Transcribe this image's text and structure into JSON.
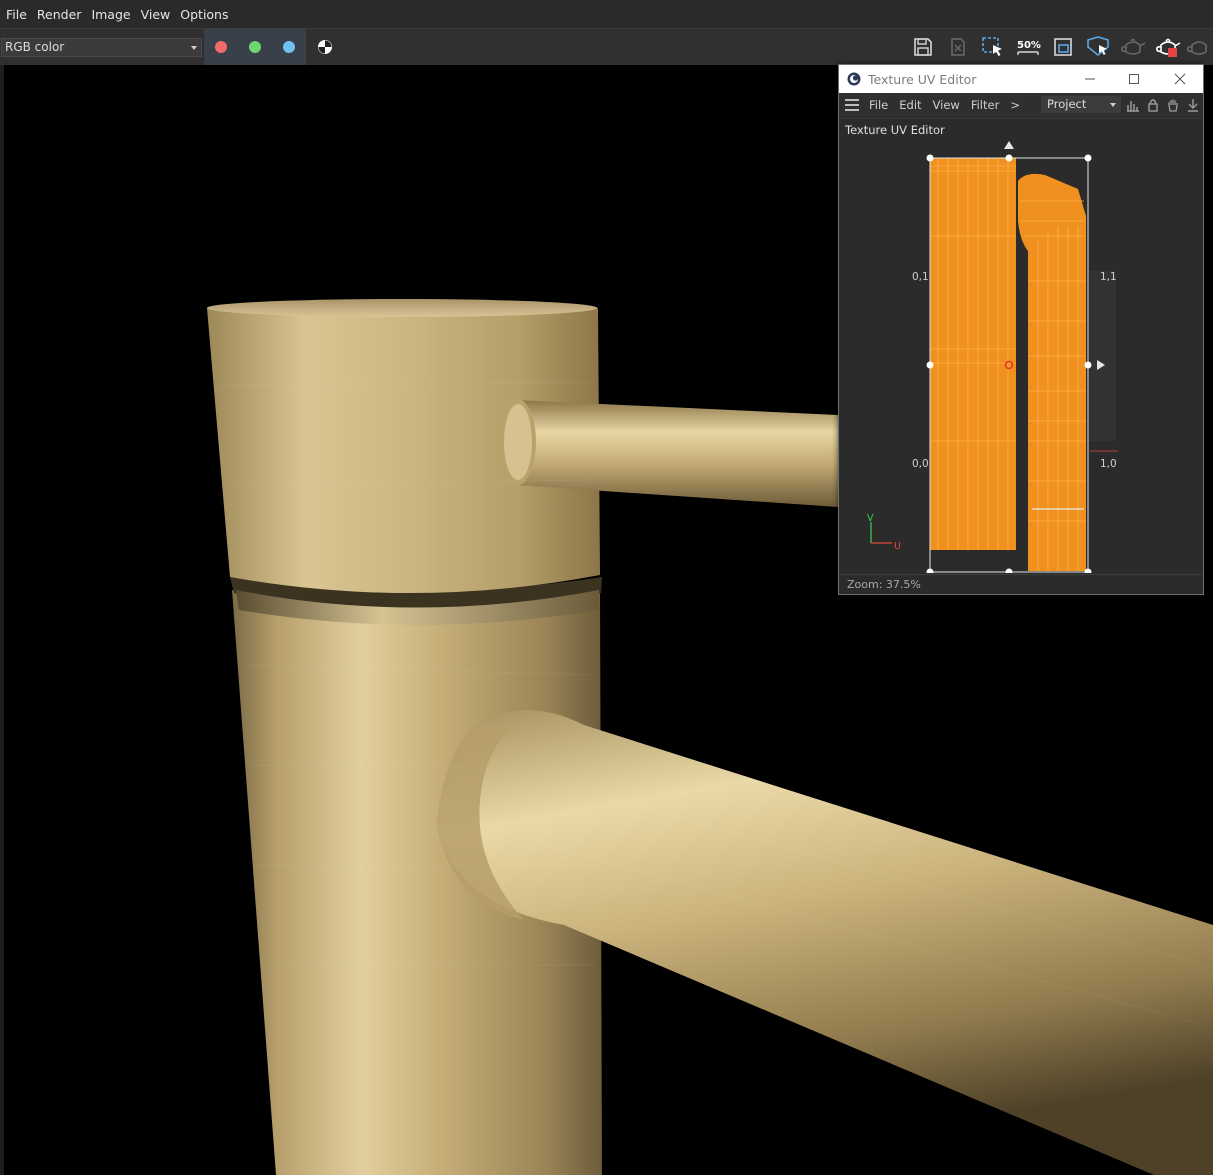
{
  "menubar": {
    "items": [
      "File",
      "Render",
      "Image",
      "View",
      "Options"
    ]
  },
  "toolbar": {
    "channel_value": "RGB color",
    "channels": [
      {
        "name": "red",
        "color": "#f26b6b"
      },
      {
        "name": "green",
        "color": "#6fd66f"
      },
      {
        "name": "blue",
        "color": "#6fc3f2"
      }
    ],
    "zoom_badge": "50%",
    "icons": [
      "save-icon",
      "delete-image-icon",
      "region-render-icon",
      "zoom-50-icon",
      "fit-view-icon",
      "interactive-region-icon",
      "teapot-render-icon",
      "teapot-stop-icon",
      "teapot-icon"
    ]
  },
  "uv_editor": {
    "window_title": "Texture UV Editor",
    "menu": [
      "File",
      "Edit",
      "View",
      "Filter",
      ">"
    ],
    "project_select": "Project",
    "panel_title": "Texture UV Editor",
    "coords": {
      "top_left": "0,1",
      "top_right": "1,1",
      "bottom_left": "0,0",
      "bottom_right": "1,0"
    },
    "axis_v": "V",
    "axis_u": "U",
    "status": "Zoom: 37.5%",
    "colors": {
      "uv_fill": "#f0901f",
      "uv_line": "#ffb24a",
      "axis_v": "#3fd24a",
      "axis_u": "#e04a3a"
    }
  },
  "viewport": {
    "background": "#000000",
    "material_color": "#c8b07a"
  }
}
